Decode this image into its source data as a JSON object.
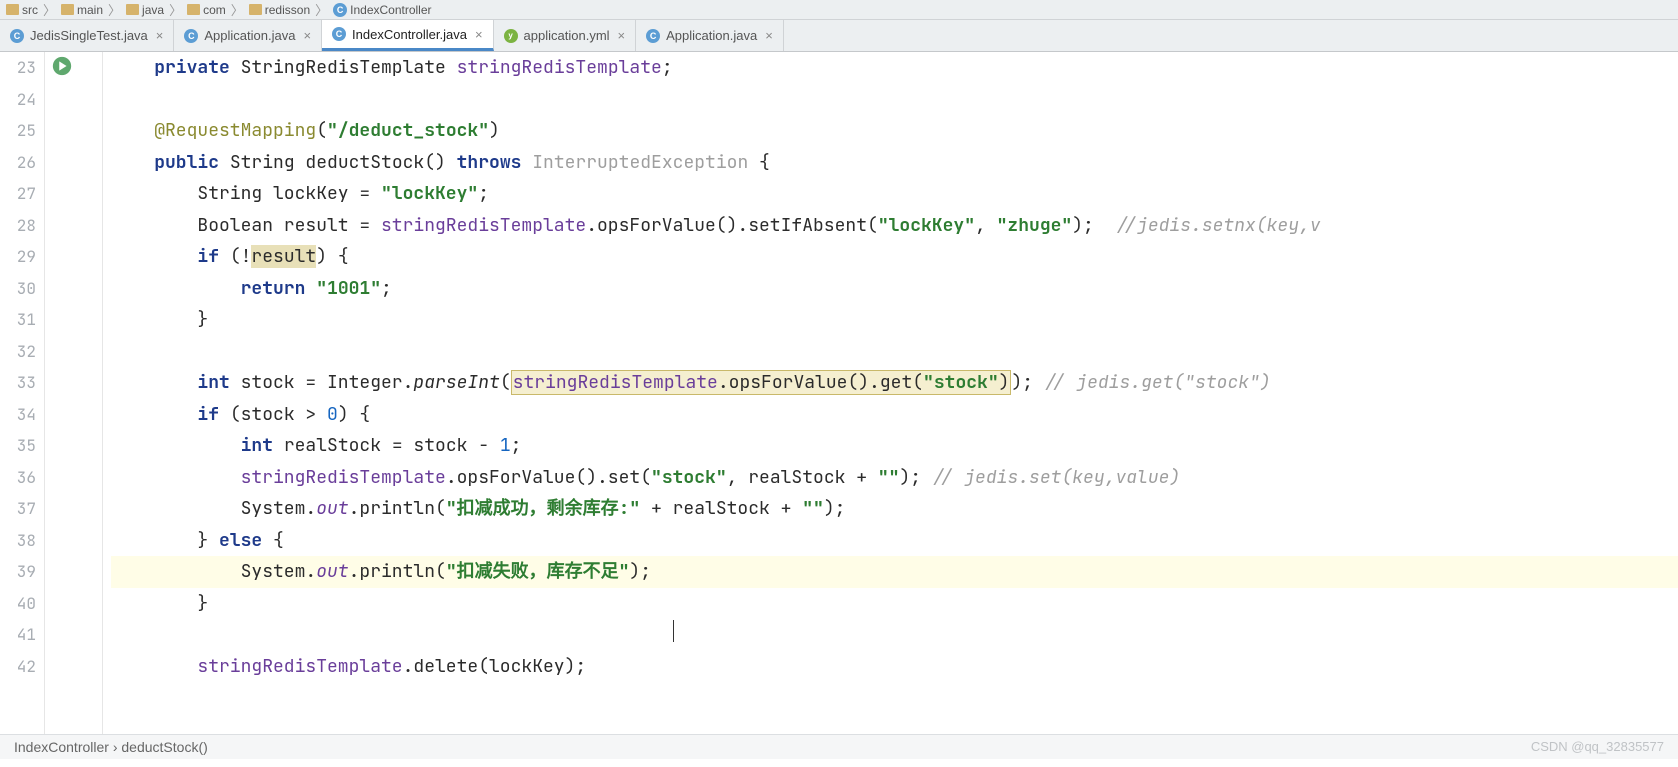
{
  "breadcrumb": {
    "items": [
      {
        "label": "src",
        "icon": "folder"
      },
      {
        "label": "main",
        "icon": "folder"
      },
      {
        "label": "java",
        "icon": "folder"
      },
      {
        "label": "com",
        "icon": "folder"
      },
      {
        "label": "redisson",
        "icon": "folder"
      },
      {
        "label": "IndexController",
        "icon": "class"
      }
    ]
  },
  "tabs": [
    {
      "label": "JedisSingleTest.java",
      "icon": "class",
      "active": false
    },
    {
      "label": "Application.java",
      "icon": "class",
      "active": false
    },
    {
      "label": "IndexController.java",
      "icon": "class",
      "active": true
    },
    {
      "label": "application.yml",
      "icon": "yml",
      "active": false
    },
    {
      "label": "Application.java",
      "icon": "class",
      "active": false
    }
  ],
  "gutter": {
    "start": 23,
    "end": 42
  },
  "code": {
    "l23_kw_private": "private",
    "l23_type": "StringRedisTemplate",
    "l23_ident": "stringRedisTemplate",
    "l25_ann": "@RequestMapping",
    "l25_str": "\"/deduct_stock\"",
    "l26_kw_public": "public",
    "l26_ret": "String",
    "l26_name": "deductStock",
    "l26_throws": "throws",
    "l26_exc": "InterruptedException",
    "l27_type": "String",
    "l27_var": "lockKey",
    "l27_str": "\"lockKey\"",
    "l28_type": "Boolean",
    "l28_var": "result",
    "l28_ident": "stringRedisTemplate",
    "l28_call1": "opsForValue",
    "l28_call2": "setIfAbsent",
    "l28_str1": "\"lockKey\"",
    "l28_str2": "\"zhuge\"",
    "l28_comm": "//jedis.setnx(key,v",
    "l29_if": "if",
    "l29_var": "result",
    "l30_ret": "return",
    "l30_str": "\"1001\"",
    "l33_int": "int",
    "l33_var": "stock",
    "l33_cls": "Integer",
    "l33_parse": "parseInt",
    "l33_expr_ident": "stringRedisTemplate",
    "l33_expr_opf": "opsForValue",
    "l33_expr_get": "get",
    "l33_expr_str": "\"stock\"",
    "l33_comm": "// jedis.get(\"stock\")",
    "l34_if": "if",
    "l34_var": "stock",
    "l34_num": "0",
    "l35_int": "int",
    "l35_var": "realStock",
    "l35_rhs": "stock",
    "l35_num": "1",
    "l36_ident": "stringRedisTemplate",
    "l36_opf": "opsForValue",
    "l36_set": "set",
    "l36_str1": "\"stock\"",
    "l36_var": "realStock",
    "l36_str2": "\"\"",
    "l36_comm": "// jedis.set(key,value)",
    "l37_sys": "System",
    "l37_out": "out",
    "l37_println": "println",
    "l37_str": "\"扣减成功，剩余库存:\"",
    "l37_var": "realStock",
    "l37_str2": "\"\"",
    "l38_else": "else",
    "l39_sys": "System",
    "l39_out": "out",
    "l39_println": "println",
    "l39_str": "\"扣减失败，库存不足\"",
    "l42_ident": "stringRedisTemplate",
    "l42_del": "delete",
    "l42_arg": "lockKey"
  },
  "bottom": {
    "class": "IndexController",
    "sep": "›",
    "method": "deductStock()"
  },
  "watermark": "CSDN @qq_32835577"
}
